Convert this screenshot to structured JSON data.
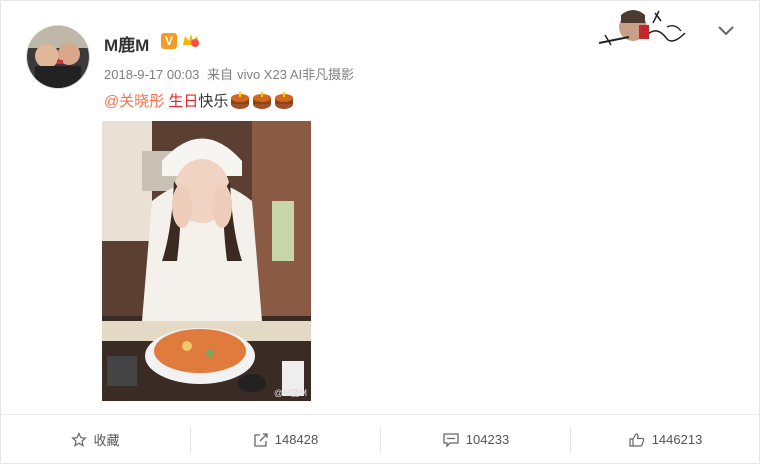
{
  "post": {
    "username": "M鹿M",
    "verified_badge": "V",
    "timestamp": "2018-9-17 00:03",
    "source_prefix": "来自",
    "source_device": "vivo X23 AI非凡摄影",
    "mention": "@关晓彤",
    "topic": "生日",
    "text": "快乐",
    "cake_emoji_count": 3,
    "photo_watermark": "@M鹿M"
  },
  "actions": {
    "favorite_label": "收藏",
    "repost_count": "148428",
    "comment_count": "104233",
    "like_count": "1446213"
  },
  "colors": {
    "mention": "#eb7350",
    "topic": "#e12828",
    "meta": "#808080",
    "badge": "#f59a23"
  },
  "icons": [
    "star-icon",
    "repost-icon",
    "comment-icon",
    "like-icon",
    "chevron-down-icon",
    "cake-icon"
  ]
}
